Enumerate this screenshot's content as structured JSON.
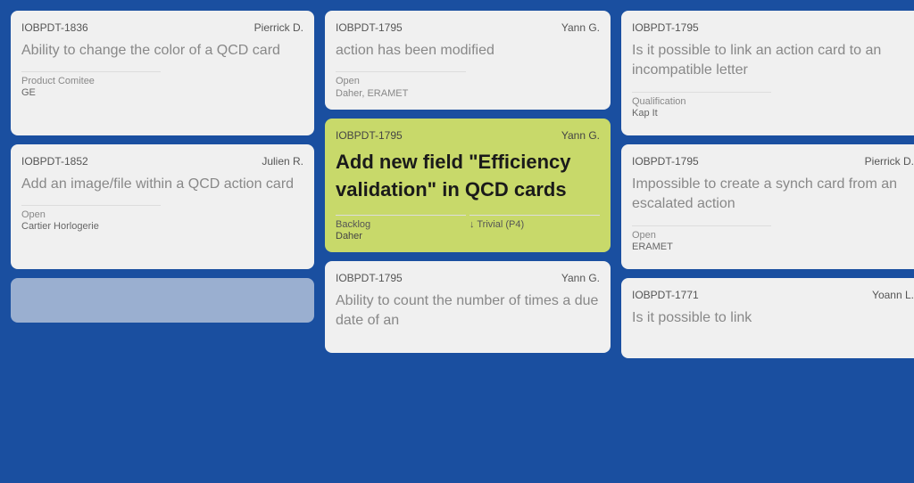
{
  "board": {
    "backgroundColor": "#1a4fa0",
    "columns": [
      {
        "cards": [
          {
            "id": "IOBPDT-1836",
            "assignee": "Pierrick D.",
            "title": "Ability to change the color of a QCD card",
            "highlighted": false,
            "footer": {
              "type": "two-col",
              "col1Label": "Product Comitee",
              "col1Value": "GE",
              "col2Label": "",
              "col2Value": ""
            }
          },
          {
            "id": "IOBPDT-1852",
            "assignee": "Julien R.",
            "title": "Add an image/file within a QCD action card",
            "highlighted": false,
            "footer": {
              "type": "two-col",
              "col1Label": "Open",
              "col1Value": "Cartier Horlogerie",
              "col2Label": "",
              "col2Value": ""
            }
          },
          {
            "id": "",
            "assignee": "",
            "title": "",
            "highlighted": false,
            "partial": true,
            "footer": {}
          }
        ]
      },
      {
        "cards": [
          {
            "id": "IOBPDT-1795",
            "assignee": "Yann G.",
            "title": "action has been modified",
            "highlighted": false,
            "footer": {
              "type": "two-col",
              "col1Label": "Open",
              "col1Value": "",
              "col2Label": "",
              "col2Value": ""
            },
            "footerExtra": {
              "label": "Daher, ERAMET"
            }
          },
          {
            "id": "IOBPDT-1795",
            "assignee": "Yann G.",
            "title": "Add new field \"Efficiency validation\" in QCD cards",
            "highlighted": true,
            "footer": {
              "type": "two-col",
              "col1Label": "Backlog",
              "col1Value": "Daher",
              "col2Label": "↓ Trivial (P4)",
              "col2Value": ""
            }
          },
          {
            "id": "IOBPDT-1795",
            "assignee": "Yann G.",
            "title": "Ability to count the number of times a due date of an",
            "highlighted": false,
            "partial": true,
            "footer": {}
          }
        ]
      },
      {
        "cards": [
          {
            "id": "IOBPDT-1795",
            "assignee": "",
            "title": "Is it possible to link an action card to an incompatible letter",
            "highlighted": false,
            "footer": {
              "type": "two-col",
              "col1Label": "Qualification",
              "col1Value": "Kap It",
              "col2Label": "",
              "col2Value": ""
            }
          },
          {
            "id": "IOBPDT-1795",
            "assignee": "Pierrick D.",
            "title": "Impossible to create a synch card from an escalated action",
            "highlighted": false,
            "footer": {
              "type": "two-col",
              "col1Label": "Open",
              "col1Value": "ERAMET",
              "col2Label": "",
              "col2Value": ""
            }
          },
          {
            "id": "IOBPDT-1771",
            "assignee": "Yoann L.",
            "title": "Is it possible to link",
            "highlighted": false,
            "partial": true,
            "footer": {}
          }
        ]
      }
    ]
  }
}
